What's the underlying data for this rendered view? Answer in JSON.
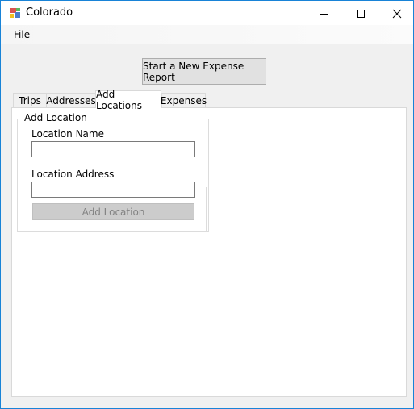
{
  "window": {
    "title": "Colorado",
    "icon": "windows-forms-app-icon"
  },
  "menu": {
    "file": "File"
  },
  "toolbar": {
    "new_report": "Start a New Expense Report"
  },
  "tabs": [
    {
      "label": "Trips",
      "selected": false
    },
    {
      "label": "Addresses",
      "selected": false
    },
    {
      "label": "Add Locations",
      "selected": true
    },
    {
      "label": "Expenses",
      "selected": false
    }
  ],
  "add_location": {
    "group_title": "Add Location",
    "name_label": "Location Name",
    "name_value": "",
    "address_label": "Location Address",
    "address_value": "",
    "submit_label": "Add Location"
  },
  "colors": {
    "window_border": "#1883d7",
    "form_background": "#f0f0f0",
    "disabled_button": "#cccccc"
  }
}
